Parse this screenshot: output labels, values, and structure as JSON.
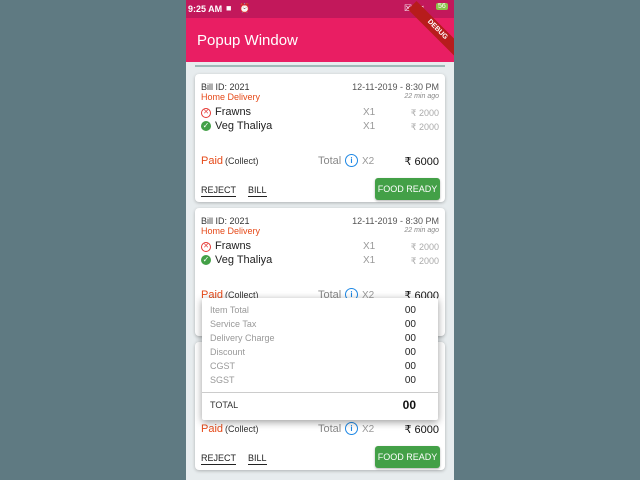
{
  "status": {
    "time": "9:25 AM",
    "battery": "56"
  },
  "app": {
    "title": "Popup Window",
    "banner": "DEBUG"
  },
  "orders": [
    {
      "bill_id": "Bill ID: 2021",
      "date": "12-11-2019 - 8:30 PM",
      "delivery_type": "Home Delivery",
      "ago": "22 min ago",
      "items": [
        {
          "name": "Frawns",
          "qty": "X1",
          "price": "₹ 2000",
          "status": "cancelled"
        },
        {
          "name": "Veg Thaliya",
          "qty": "X1",
          "price": "₹ 2000",
          "status": "done"
        }
      ],
      "paid": "Paid",
      "collect": "(Collect)",
      "total_label": "Total",
      "total_qty": "X2",
      "total_price": "₹ 6000",
      "reject": "REJECT",
      "bill": "BILL",
      "action": "FOOD READY"
    },
    {
      "bill_id": "Bill ID: 2021",
      "date": "12-11-2019 - 8:30 PM",
      "delivery_type": "Home Delivery",
      "ago": "22 min ago",
      "items": [
        {
          "name": "Frawns",
          "qty": "X1",
          "price": "₹ 2000",
          "status": "cancelled"
        },
        {
          "name": "Veg Thaliya",
          "qty": "X1",
          "price": "₹ 2000",
          "status": "done"
        }
      ],
      "paid": "Paid",
      "collect": "(Collect)",
      "total_label": "Total",
      "total_qty": "X2",
      "total_price": "₹ 6000"
    },
    {
      "paid": "Paid",
      "collect": "(Collect)",
      "total_label": "Total",
      "total_qty": "X2",
      "total_price": "₹ 6000",
      "reject": "REJECT",
      "bill": "BILL",
      "action": "FOOD READY"
    }
  ],
  "popup": {
    "rows": [
      {
        "label": "Item Total",
        "value": "00"
      },
      {
        "label": "Service Tax",
        "value": "00"
      },
      {
        "label": "Delivery Charge",
        "value": "00"
      },
      {
        "label": "Discount",
        "value": "00"
      },
      {
        "label": "CGST",
        "value": "00"
      },
      {
        "label": "SGST",
        "value": "00"
      }
    ],
    "total_label": "TOTAL",
    "total_value": "00"
  },
  "colors": {
    "appbar": "#e91e63",
    "statusbar": "#c2185b",
    "accent_orange": "#e64a19",
    "button_green": "#43a047"
  }
}
